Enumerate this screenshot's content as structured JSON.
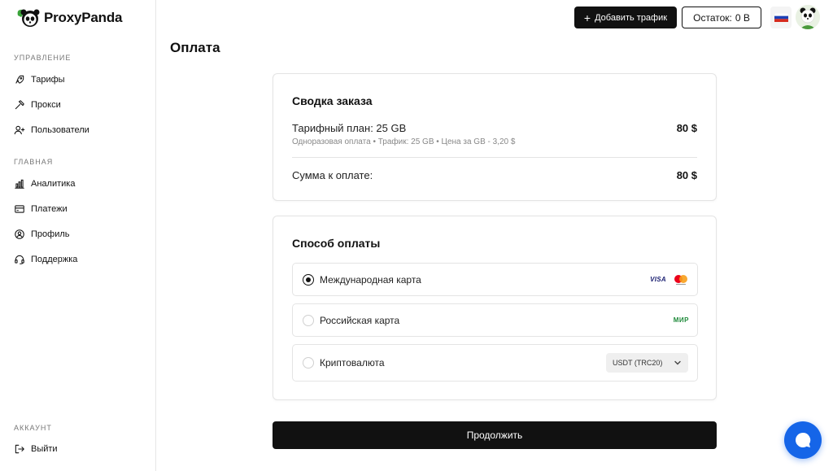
{
  "brand": {
    "name": "ProxyPanda"
  },
  "sidebar": {
    "sections": [
      {
        "title": "УПРАВЛЕНИЕ"
      },
      {
        "title": "ГЛАВНАЯ"
      },
      {
        "title": "АККАУНТ"
      }
    ],
    "items": [
      {
        "label": "Тарифы",
        "icon": "rocket-icon"
      },
      {
        "label": "Прокси",
        "icon": "hammer-icon"
      },
      {
        "label": "Пользователи",
        "icon": "user-plus-icon"
      },
      {
        "label": "Аналитика",
        "icon": "bar-chart-icon"
      },
      {
        "label": "Платежи",
        "icon": "card-icon"
      },
      {
        "label": "Профиль",
        "icon": "profile-icon"
      },
      {
        "label": "Поддержка",
        "icon": "headset-icon"
      },
      {
        "label": "Выйти",
        "icon": "logout-icon"
      }
    ]
  },
  "header": {
    "add_traffic_label": "Добавить трафик",
    "balance_label": "Остаток:",
    "balance_value": "0 B"
  },
  "page": {
    "title": "Оплата"
  },
  "summary": {
    "title": "Сводка заказа",
    "plan_label": "Тарифный план: 25 GB",
    "plan_price": "80 $",
    "plan_details": "Одноразовая оплата • Трафик: 25 GB • Цена за GB - 3,20 $",
    "total_label": "Сумма к оплате:",
    "total_value": "80 $"
  },
  "payment": {
    "title": "Способ оплаты",
    "options": [
      {
        "label": "Международная карта",
        "selected": true,
        "badges": [
          "VISA",
          "mastercard"
        ]
      },
      {
        "label": "Российская карта",
        "selected": false,
        "badges": [
          "МИР"
        ]
      },
      {
        "label": "Криптовалюта",
        "selected": false,
        "select_value": "USDT (TRC20)"
      }
    ]
  },
  "continue_label": "Продолжить",
  "colors": {
    "primary": "#111111",
    "chat": "#1565e8",
    "mir": "#1e8a3a",
    "visa": "#1a1f71"
  }
}
